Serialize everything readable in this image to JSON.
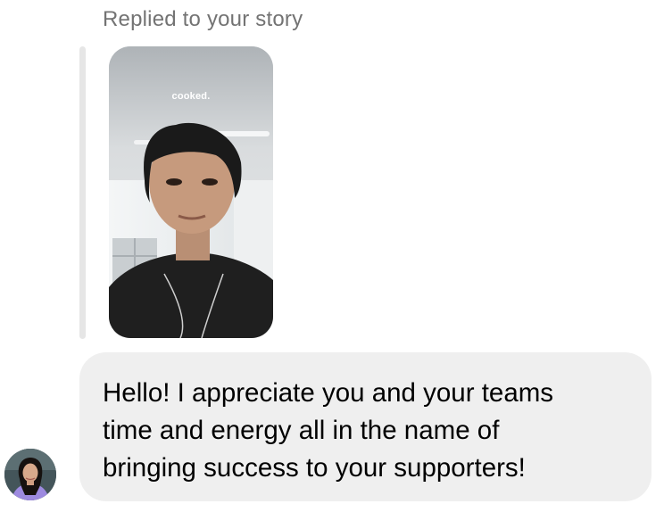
{
  "reply": {
    "label": "Replied to your story"
  },
  "story": {
    "caption": "cooked.",
    "thumbnail": "story-thumbnail-person-selfie"
  },
  "message": {
    "lines": [
      "Hello! I appreciate you and your teams",
      "time and energy all in the name of",
      "bringing success to your supporters!"
    ]
  },
  "sender": {
    "avatar": "sender-avatar-photo"
  },
  "colors": {
    "label_gray": "#737373",
    "bubble_bg": "#efefef",
    "reply_line": "#e6e6e6",
    "text": "#000000"
  }
}
